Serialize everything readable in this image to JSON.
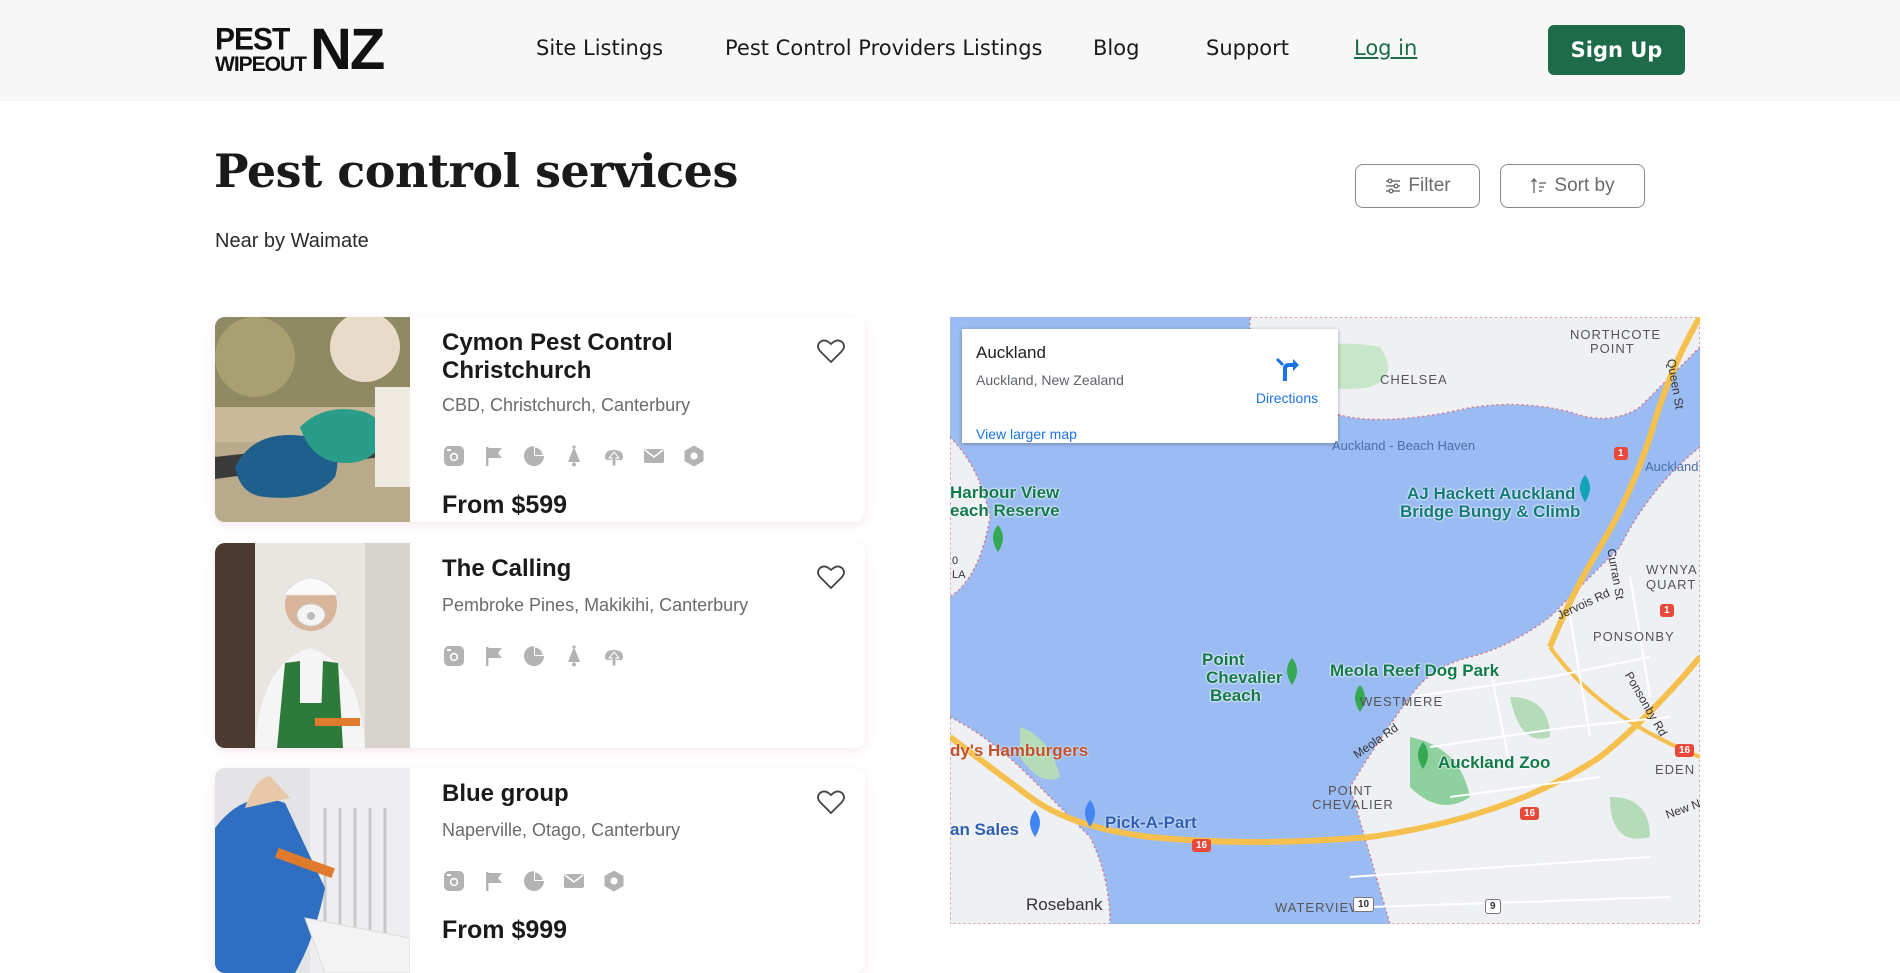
{
  "header": {
    "logo_top": "PEST",
    "logo_bottom": "WIPEOUT",
    "logo_nz": "NZ",
    "nav": [
      "Site Listings",
      "Pest Control Providers Listings",
      "Blog",
      "Support"
    ],
    "login": "Log in",
    "signup": "Sign Up"
  },
  "page": {
    "title": "Pest control services",
    "subtitle": "Near by Waimate",
    "filter_label": "Filter",
    "sort_label": "Sort by"
  },
  "listings": [
    {
      "name": "Cymon Pest Control Christchurch",
      "location": "CBD, Christchurch, Canterbury",
      "price": "From $599",
      "icons": [
        "instagram-icon",
        "flag-icon",
        "pie-chart-icon",
        "bell-icon",
        "upload-icon",
        "mail-icon",
        "hexagon-icon"
      ]
    },
    {
      "name": "The Calling",
      "location": "Pembroke Pines, Makikihi, Canterbury",
      "price": "",
      "icons": [
        "instagram-icon",
        "flag-icon",
        "pie-chart-icon",
        "bell-icon",
        "upload-icon"
      ]
    },
    {
      "name": "Blue group",
      "location": "Naperville, Otago, Canterbury",
      "price": "From $999",
      "icons": [
        "instagram-icon",
        "flag-icon",
        "pie-chart-icon",
        "mail-icon",
        "hexagon-icon"
      ]
    }
  ],
  "map": {
    "place_name": "Auckland",
    "place_address": "Auckland, New Zealand",
    "directions": "Directions",
    "larger_map": "View larger map",
    "labels": {
      "chelsea": "CHELSEA",
      "northcote": "NORTHCOTE",
      "point": "POINT",
      "beach_haven": "Auckland - Beach Haven",
      "auckland_edge": "Auckland -",
      "harbour_view": "Harbour View",
      "each_reserve": "each Reserve",
      "aj_hackett": "AJ Hackett Auckland",
      "bridge_bungy": "Bridge Bungy & Climb",
      "wynyard": "WYNYA",
      "quart": "QUART",
      "ponsonby": "PONSONBY",
      "jervois": "Jervois Rd",
      "curran": "Curran St",
      "point_chevalier_beach_1": "Point",
      "point_chevalier_beach_2": "Chevalier",
      "point_chevalier_beach_3": "Beach",
      "meola_reef": "Meola Reef Dog Park",
      "westmere": "WESTMERE",
      "meola_rd": "Meola Rd",
      "auckland_zoo": "Auckland Zoo",
      "hamburgers": "dy's Hamburgers",
      "point_chevalier_1": "POINT",
      "point_chevalier_2": "CHEVALIER",
      "pick_a_part": "Pick-A-Part",
      "an_sales": "an Sales",
      "rosebank": "Rosebank",
      "waterview": "WATERVIEW",
      "eden": "EDEN",
      "ponsonby_rd": "Ponsonby Rd",
      "queen_st": "Queen St",
      "new_n": "New N",
      "o_la": "LA",
      "o_zero": "0",
      "shield_1": "1",
      "shield_16": "16",
      "shield_10": "10",
      "shield_9": "9"
    }
  }
}
